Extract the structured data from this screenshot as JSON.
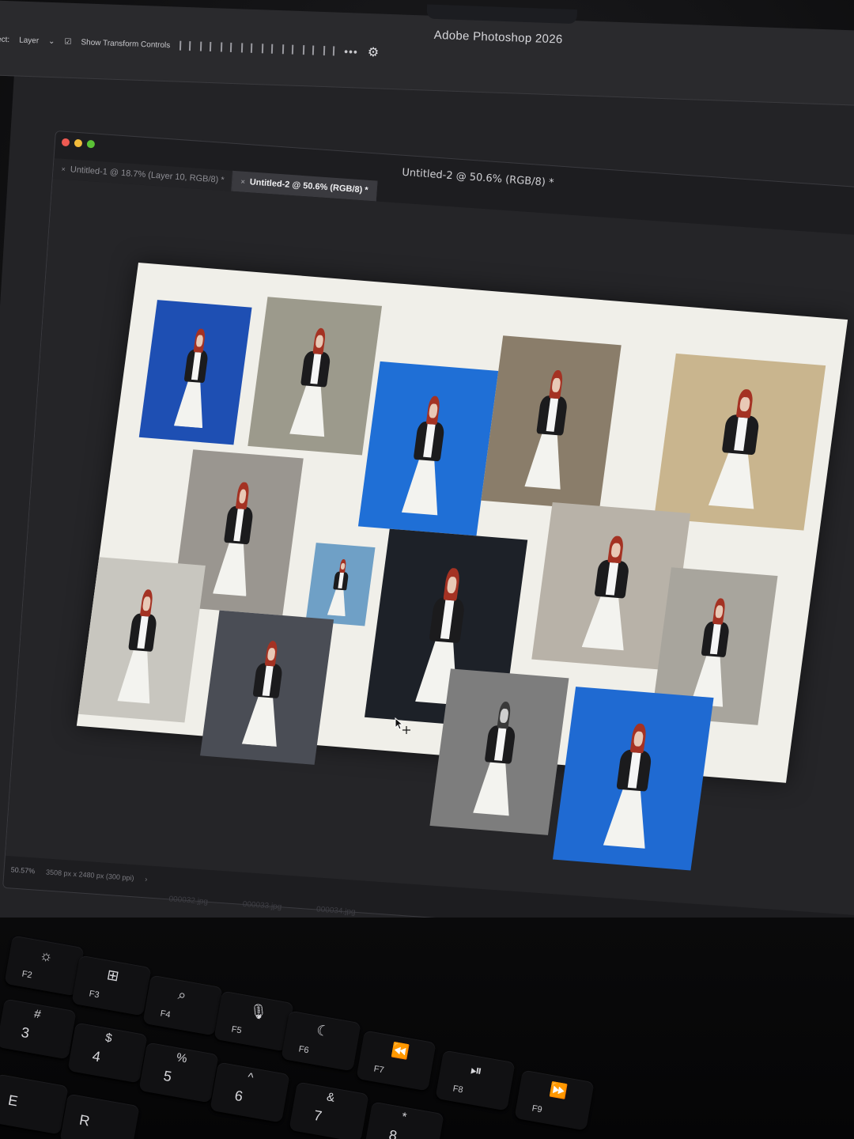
{
  "app": {
    "title": "Adobe Photoshop 2026"
  },
  "options_bar": {
    "auto_select_label": "-Select:",
    "layer_dropdown": "Layer",
    "show_transform_controls": "Show Transform Controls",
    "more_label": "•••"
  },
  "document": {
    "title": "Untitled-2 @ 50.6% (RGB/8) *",
    "tabs": [
      {
        "label": "Untitled-1 @ 18.7% (Layer 10, RGB/8) *",
        "active": false
      },
      {
        "label": "Untitled-2 @ 50.6% (RGB/8) *",
        "active": true
      }
    ],
    "status": {
      "zoom": "50.57%",
      "dimensions": "3508 px x 2480 px (300 ppi)"
    },
    "files": [
      "000032.jpg",
      "000033.jpg",
      "000034.jpg"
    ]
  },
  "artboard": {
    "background": "#f0efe9",
    "photos": [
      {
        "bg": "#1e4fb3",
        "style": "color"
      },
      {
        "bg": "#9c9a8c",
        "style": "color"
      },
      {
        "bg": "#1f6fd6",
        "style": "color"
      },
      {
        "bg": "#8a7d6a",
        "style": "color"
      },
      {
        "bg": "#c9b58e",
        "style": "color"
      },
      {
        "bg": "#9a9690",
        "style": "color"
      },
      {
        "bg": "#6fa0c6",
        "style": "color"
      },
      {
        "bg": "#1d2128",
        "style": "dark"
      },
      {
        "bg": "#b8b2a8",
        "style": "color"
      },
      {
        "bg": "#a8a59d",
        "style": "color"
      },
      {
        "bg": "#c8c6bf",
        "style": "color"
      },
      {
        "bg": "#4a4d55",
        "style": "color"
      },
      {
        "bg": "#7d7d7d",
        "style": "bw"
      },
      {
        "bg": "#1f6ad2",
        "style": "color"
      }
    ]
  },
  "keyboard": {
    "keys": [
      {
        "fn": "F2",
        "glyph": "☼"
      },
      {
        "fn": "F3",
        "glyph": "⊞"
      },
      {
        "fn": "F4",
        "glyph": "⌕"
      },
      {
        "fn": "F5",
        "glyph": "🎙"
      },
      {
        "fn": "F6",
        "glyph": "☾"
      },
      {
        "fn": "F7",
        "glyph": "⏪"
      },
      {
        "fn": "F8",
        "glyph": "⏯"
      },
      {
        "fn": "F9",
        "glyph": "⏩"
      }
    ],
    "number_keys": [
      {
        "main": "3",
        "alt": "#"
      },
      {
        "main": "4",
        "alt": "$"
      },
      {
        "main": "5",
        "alt": "%"
      },
      {
        "main": "6",
        "alt": "^"
      },
      {
        "main": "7",
        "alt": "&"
      },
      {
        "main": "8",
        "alt": "*"
      }
    ],
    "letter_keys": [
      "E",
      "R"
    ]
  }
}
